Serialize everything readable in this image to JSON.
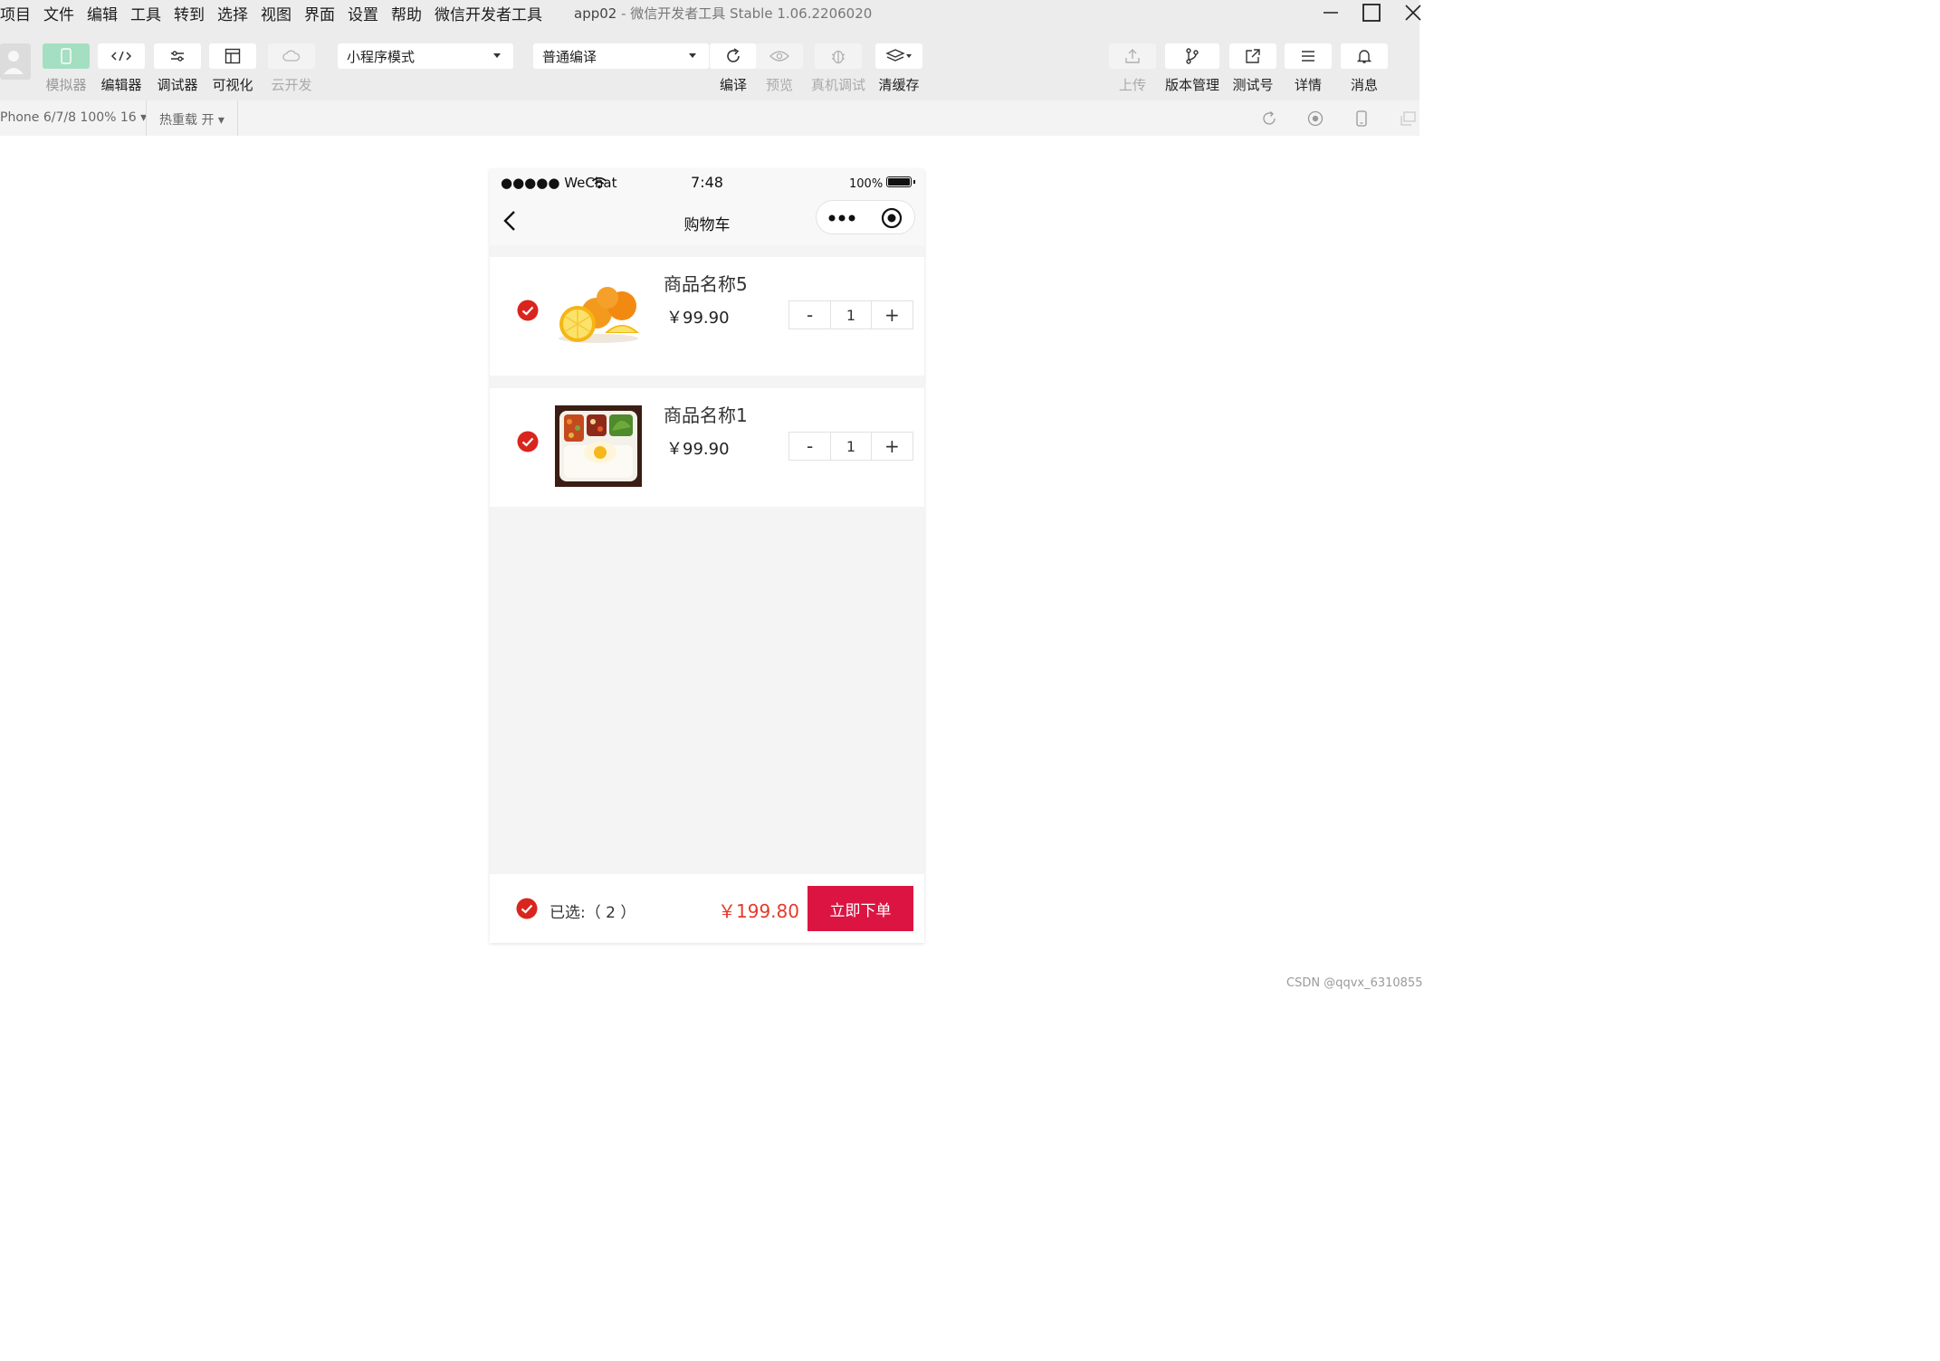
{
  "menubar": {
    "items": [
      "项目",
      "文件",
      "编辑",
      "工具",
      "转到",
      "选择",
      "视图",
      "界面",
      "设置",
      "帮助",
      "微信开发者工具"
    ],
    "app_name": "app02",
    "title_sep": " - ",
    "title_rest": "微信开发者工具 Stable 1.06.2206020"
  },
  "toolbar": {
    "simulator": "模拟器",
    "editor": "编辑器",
    "debugger": "调试器",
    "visual": "可视化",
    "cloud": "云开发",
    "mode_select": "小程序模式",
    "compile_select": "普通编译",
    "compile": "编译",
    "preview": "预览",
    "remote_debug": "真机调试",
    "clear_cache": "清缓存",
    "upload": "上传",
    "version": "版本管理",
    "test_account": "测试号",
    "details": "详情",
    "messages": "消息"
  },
  "subbar": {
    "device": "Phone 6/7/8 100% 16 ▾",
    "hot_reload": "热重载 开 ▾"
  },
  "phone": {
    "carrier": "●●●●● WeChat",
    "time": "7:48",
    "battery": "100%",
    "page_title": "购物车"
  },
  "cart": {
    "items": [
      {
        "name": "商品名称5",
        "price": "￥99.90",
        "qty": "1",
        "minus": "-",
        "plus": "+",
        "image": "orange-image",
        "checked": true
      },
      {
        "name": "商品名称1",
        "price": "￥99.90",
        "qty": "1",
        "minus": "-",
        "plus": "+",
        "image": "bento-image",
        "checked": true
      }
    ],
    "selected_label": "已选:（ 2 ）",
    "total": "￥199.80",
    "order_button": "立即下单"
  },
  "colors": {
    "accent_red": "#dc1442",
    "price_red": "#e53a2a",
    "check_red": "#d9251d",
    "simulator_active": "#a4dfc2"
  },
  "watermark": "CSDN @qqvx_6310855"
}
